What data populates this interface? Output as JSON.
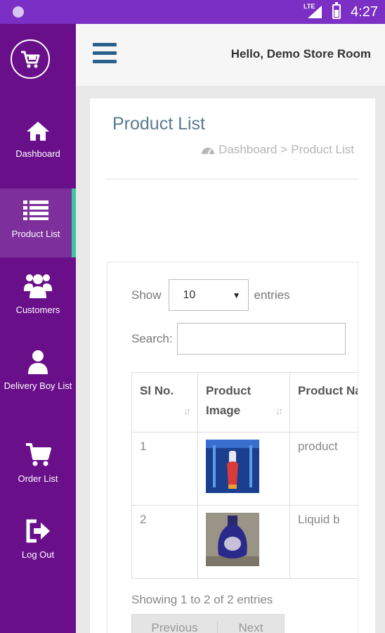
{
  "status_bar": {
    "network": "LTE",
    "time": "4:27"
  },
  "header": {
    "greeting": "Hello, Demo Store Room"
  },
  "sidebar": {
    "items": [
      {
        "label": "Dashboard",
        "icon": "home-icon"
      },
      {
        "label": "Product List",
        "icon": "list-icon",
        "active": true
      },
      {
        "label": "Customers",
        "icon": "users-icon"
      },
      {
        "label": "Delivery Boy List",
        "icon": "user-icon"
      },
      {
        "label": "Order List",
        "icon": "cart-icon"
      },
      {
        "label": "Log Out",
        "icon": "logout-icon"
      }
    ]
  },
  "page": {
    "title": "Product List",
    "breadcrumb": {
      "home": "Dashboard",
      "separator": ">",
      "current": "Product List"
    }
  },
  "table_controls": {
    "show_label": "Show",
    "page_size": "10",
    "entries_label": "entries",
    "search_label": "Search:",
    "search_value": ""
  },
  "table": {
    "headers": [
      "Sl No.",
      "Product Image",
      "Product Name"
    ],
    "rows": [
      {
        "no": "1",
        "name": "product"
      },
      {
        "no": "2",
        "name": "Liquid b"
      }
    ]
  },
  "footer": {
    "info": "Showing 1 to 2 of 2 entries",
    "previous": "Previous",
    "next": "Next"
  },
  "colors": {
    "sidebar": "#6a0f8a",
    "status_bar": "#7b2fc4",
    "active_indicator": "#3ec6a4",
    "menu_icon": "#2b5f8c"
  }
}
